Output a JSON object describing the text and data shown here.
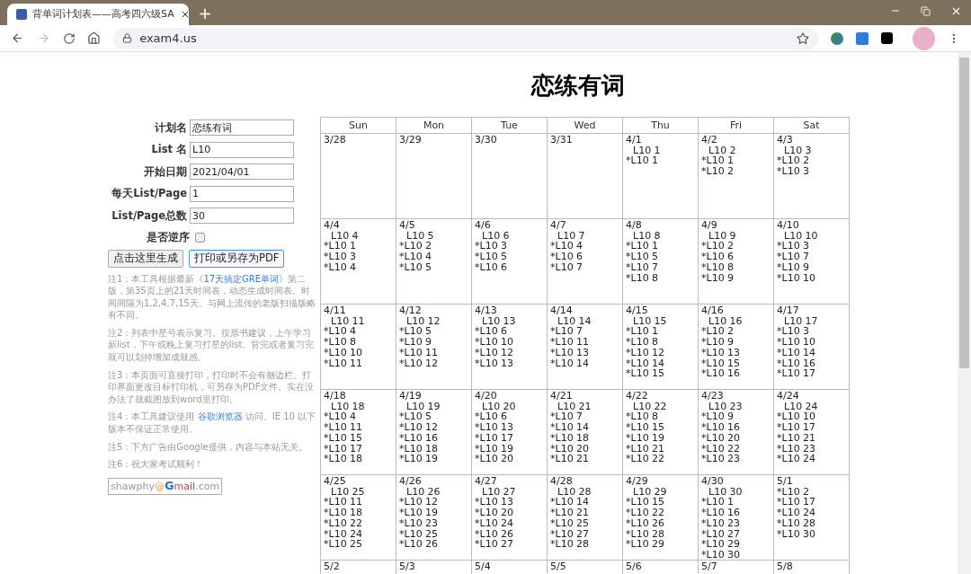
{
  "browser": {
    "tab_title": "背单词计划表——高考四六级SA",
    "new_tab": "+",
    "url": "exam4.us"
  },
  "page_title": "恋练有词",
  "form": {
    "fields": [
      {
        "label": "计划名",
        "value": "恋练有词"
      },
      {
        "label": "List 名",
        "value": "L10"
      },
      {
        "label": "开始日期",
        "value": "2021/04/01"
      },
      {
        "label": "每天List/Page",
        "value": "1"
      },
      {
        "label": "List/Page总数",
        "value": "30"
      }
    ],
    "reverse": {
      "label": "是否逆序",
      "checked": false
    },
    "buttons": [
      {
        "label": "点击这里生成",
        "selected": false
      },
      {
        "label": "打印或另存为PDF",
        "selected": true
      }
    ]
  },
  "notes": [
    {
      "before": "注1：本工具根据最新《",
      "link": "17天搞定GRE单词",
      "after": "》第二版，第35页上的21天时间表，动态生成时间表。时间间隔为1,2,4,7,15天。与网上流传的老版扫描版略有不同。"
    },
    {
      "before": "注2：列表中星号表示复习。按原书建议，上午学习新list，下午或晚上复习打星的list。背完或者复习完就可以划掉增加成就感。"
    },
    {
      "before": "注3：本页面可直接打印，打印时不会有侧边栏。打印界面更改目标打印机，可另存为PDF文件。实在没办法了就截图放到word里打印。"
    },
    {
      "before": "注4：本工具建议使用 ",
      "link": "谷歌浏览器",
      "after": " 访问。IE 10 以下版本不保证正常使用。"
    },
    {
      "before": "注5：下方广告由Google提供，内容与本站无关。"
    },
    {
      "before": "注6：祝大家考试顺利！"
    }
  ],
  "email_badge": {
    "user": "shawphy",
    "at": "@",
    "service_g": "G",
    "service_rest": "mail",
    "suffix": ".com"
  },
  "calendar": {
    "days": [
      "Sun",
      "Mon",
      "Tue",
      "Wed",
      "Thu",
      "Fri",
      "Sat"
    ],
    "weeks": [
      [
        {
          "date": "3/28"
        },
        {
          "date": "3/29"
        },
        {
          "date": "3/30"
        },
        {
          "date": "3/31"
        },
        {
          "date": "4/1",
          "new": "L10 1",
          "reviews": [
            "*L10 1"
          ]
        },
        {
          "date": "4/2",
          "new": "L10 2",
          "reviews": [
            "*L10 1",
            "*L10 2"
          ]
        },
        {
          "date": "4/3",
          "new": "L10 3",
          "reviews": [
            "*L10 2",
            "*L10 3"
          ]
        }
      ],
      [
        {
          "date": "4/4",
          "new": "L10 4",
          "reviews": [
            "*L10 1",
            "*L10 3",
            "*L10 4"
          ]
        },
        {
          "date": "4/5",
          "new": "L10 5",
          "reviews": [
            "*L10 2",
            "*L10 4",
            "*L10 5"
          ]
        },
        {
          "date": "4/6",
          "new": "L10 6",
          "reviews": [
            "*L10 3",
            "*L10 5",
            "*L10 6"
          ]
        },
        {
          "date": "4/7",
          "new": "L10 7",
          "reviews": [
            "*L10 4",
            "*L10 6",
            "*L10 7"
          ]
        },
        {
          "date": "4/8",
          "new": "L10 8",
          "reviews": [
            "*L10 1",
            "*L10 5",
            "*L10 7",
            "*L10 8"
          ]
        },
        {
          "date": "4/9",
          "new": "L10 9",
          "reviews": [
            "*L10 2",
            "*L10 6",
            "*L10 8",
            "*L10 9"
          ]
        },
        {
          "date": "4/10",
          "new": "L10 10",
          "reviews": [
            "*L10 3",
            "*L10 7",
            "*L10 9",
            "*L10 10"
          ]
        }
      ],
      [
        {
          "date": "4/11",
          "new": "L10 11",
          "reviews": [
            "*L10 4",
            "*L10 8",
            "*L10 10",
            "*L10 11"
          ]
        },
        {
          "date": "4/12",
          "new": "L10 12",
          "reviews": [
            "*L10 5",
            "*L10 9",
            "*L10 11",
            "*L10 12"
          ]
        },
        {
          "date": "4/13",
          "new": "L10 13",
          "reviews": [
            "*L10 6",
            "*L10 10",
            "*L10 12",
            "*L10 13"
          ]
        },
        {
          "date": "4/14",
          "new": "L10 14",
          "reviews": [
            "*L10 7",
            "*L10 11",
            "*L10 13",
            "*L10 14"
          ]
        },
        {
          "date": "4/15",
          "new": "L10 15",
          "reviews": [
            "*L10 1",
            "*L10 8",
            "*L10 12",
            "*L10 14",
            "*L10 15"
          ]
        },
        {
          "date": "4/16",
          "new": "L10 16",
          "reviews": [
            "*L10 2",
            "*L10 9",
            "*L10 13",
            "*L10 15",
            "*L10 16"
          ]
        },
        {
          "date": "4/17",
          "new": "L10 17",
          "reviews": [
            "*L10 3",
            "*L10 10",
            "*L10 14",
            "*L10 16",
            "*L10 17"
          ]
        }
      ],
      [
        {
          "date": "4/18",
          "new": "L10 18",
          "reviews": [
            "*L10 4",
            "*L10 11",
            "*L10 15",
            "*L10 17",
            "*L10 18"
          ]
        },
        {
          "date": "4/19",
          "new": "L10 19",
          "reviews": [
            "*L10 5",
            "*L10 12",
            "*L10 16",
            "*L10 18",
            "*L10 19"
          ]
        },
        {
          "date": "4/20",
          "new": "L10 20",
          "reviews": [
            "*L10 6",
            "*L10 13",
            "*L10 17",
            "*L10 19",
            "*L10 20"
          ]
        },
        {
          "date": "4/21",
          "new": "L10 21",
          "reviews": [
            "*L10 7",
            "*L10 14",
            "*L10 18",
            "*L10 20",
            "*L10 21"
          ]
        },
        {
          "date": "4/22",
          "new": "L10 22",
          "reviews": [
            "*L10 8",
            "*L10 15",
            "*L10 19",
            "*L10 21",
            "*L10 22"
          ]
        },
        {
          "date": "4/23",
          "new": "L10 23",
          "reviews": [
            "*L10 9",
            "*L10 16",
            "*L10 20",
            "*L10 22",
            "*L10 23"
          ]
        },
        {
          "date": "4/24",
          "new": "L10 24",
          "reviews": [
            "*L10 10",
            "*L10 17",
            "*L10 21",
            "*L10 23",
            "*L10 24"
          ]
        }
      ],
      [
        {
          "date": "4/25",
          "new": "L10 25",
          "reviews": [
            "*L10 11",
            "*L10 18",
            "*L10 22",
            "*L10 24",
            "*L10 25"
          ]
        },
        {
          "date": "4/26",
          "new": "L10 26",
          "reviews": [
            "*L10 12",
            "*L10 19",
            "*L10 23",
            "*L10 25",
            "*L10 26"
          ]
        },
        {
          "date": "4/27",
          "new": "L10 27",
          "reviews": [
            "*L10 13",
            "*L10 20",
            "*L10 24",
            "*L10 26",
            "*L10 27"
          ]
        },
        {
          "date": "4/28",
          "new": "L10 28",
          "reviews": [
            "*L10 14",
            "*L10 21",
            "*L10 25",
            "*L10 27",
            "*L10 28"
          ]
        },
        {
          "date": "4/29",
          "new": "L10 29",
          "reviews": [
            "*L10 15",
            "*L10 22",
            "*L10 26",
            "*L10 28",
            "*L10 29"
          ]
        },
        {
          "date": "4/30",
          "new": "L10 30",
          "reviews": [
            "*L10 1",
            "*L10 16",
            "*L10 23",
            "*L10 27",
            "*L10 29",
            "*L10 30"
          ]
        },
        {
          "date": "5/1",
          "reviews": [
            "*L10 2",
            "*L10 17",
            "*L10 24",
            "*L10 28",
            "*L10 30"
          ]
        }
      ],
      [
        {
          "date": "5/2"
        },
        {
          "date": "5/3"
        },
        {
          "date": "5/4"
        },
        {
          "date": "5/5"
        },
        {
          "date": "5/6"
        },
        {
          "date": "5/7"
        },
        {
          "date": "5/8"
        }
      ]
    ]
  }
}
